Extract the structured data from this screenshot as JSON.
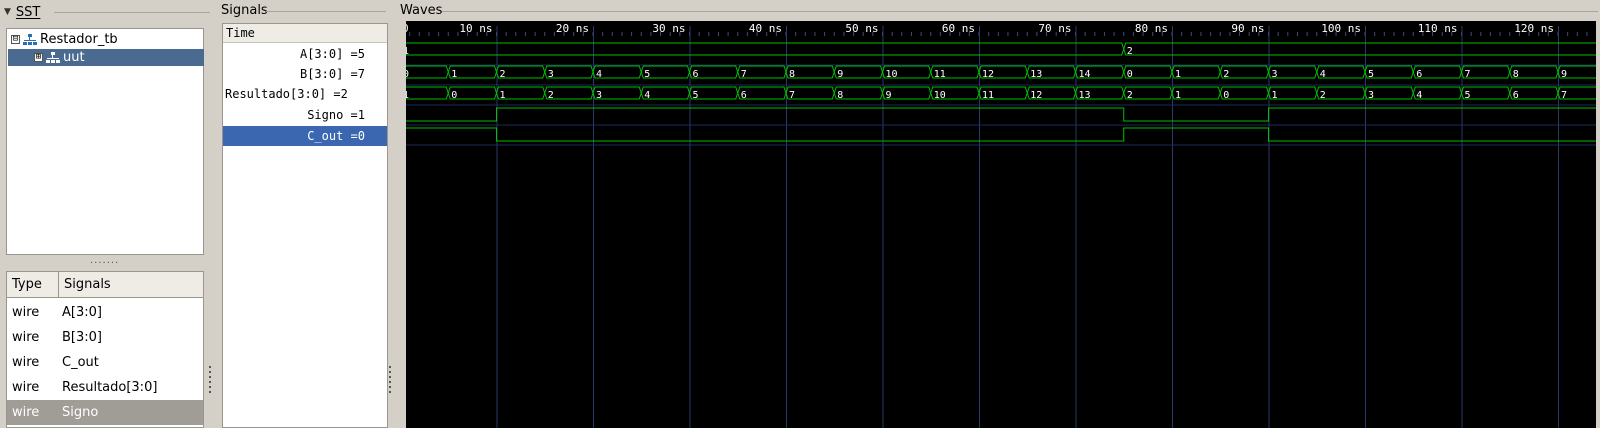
{
  "sst": {
    "title": "SST",
    "tree": [
      {
        "label": "Restador_tb",
        "expander": "⊟",
        "selected": false
      },
      {
        "label": "uut",
        "expander": "⊞",
        "selected": true
      }
    ],
    "table_headers": {
      "type": "Type",
      "signals": "Signals"
    },
    "rows": [
      {
        "type": "wire",
        "name": "A[3:0]",
        "selected": false
      },
      {
        "type": "wire",
        "name": "B[3:0]",
        "selected": false
      },
      {
        "type": "wire",
        "name": "C_out",
        "selected": false
      },
      {
        "type": "wire",
        "name": "Resultado[3:0]",
        "selected": false
      },
      {
        "type": "wire",
        "name": "Signo",
        "selected": true
      }
    ]
  },
  "signals_panel": {
    "title": "Signals",
    "time_label": "Time",
    "items": [
      {
        "label": "A[3:0] =5",
        "selected": false
      },
      {
        "label": "B[3:0] =7",
        "selected": false
      },
      {
        "label": "Resultado[3:0] =2",
        "selected": false
      },
      {
        "label": "Signo =1",
        "selected": false
      },
      {
        "label": "C_out =0",
        "selected": true
      }
    ]
  },
  "waves_panel": {
    "title": "Waves",
    "ticks": [
      "0",
      "10 ns",
      "20 ns",
      "30 ns",
      "40 ns",
      "50 ns",
      "60 ns",
      "70 ns",
      "80 ns",
      "90 ns",
      "100 ns",
      "110 ns",
      "120 ns"
    ],
    "bus_A": {
      "segments": [
        [
          "1",
          0,
          75
        ],
        [
          "2",
          75,
          125
        ]
      ]
    },
    "bus_B": {
      "values": [
        "0",
        "1",
        "2",
        "3",
        "4",
        "5",
        "6",
        "7",
        "8",
        "9",
        "10",
        "11",
        "12",
        "13",
        "14",
        "0",
        "1",
        "2",
        "3",
        "4",
        "5",
        "6",
        "7",
        "8",
        "9"
      ]
    },
    "bus_Resultado": {
      "values": [
        "1",
        "0",
        "1",
        "2",
        "3",
        "4",
        "5",
        "6",
        "7",
        "8",
        "9",
        "10",
        "11",
        "12",
        "13",
        "2",
        "1",
        "0",
        "1",
        "2",
        "3",
        "4",
        "5",
        "6",
        "7"
      ]
    },
    "signo_edges": [
      [
        0,
        0
      ],
      [
        10,
        1
      ],
      [
        75,
        0
      ],
      [
        90,
        1
      ]
    ],
    "cout_edges": [
      [
        0,
        1
      ],
      [
        10,
        0
      ],
      [
        75,
        1
      ],
      [
        90,
        0
      ]
    ],
    "colors": {
      "trace": "#00c000",
      "grid": "#2a3a6a",
      "text": "#ffffff",
      "background": "#000000"
    }
  }
}
